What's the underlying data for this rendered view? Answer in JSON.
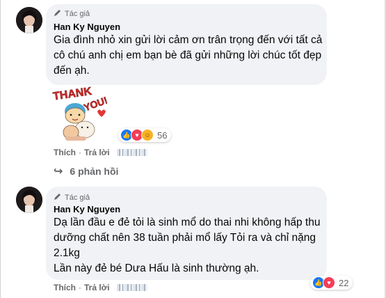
{
  "comments": [
    {
      "badge": "Tác giả",
      "author": "Han Ky Nguyen",
      "lines": [
        "Gia đình nhỏ xin gửi lời cảm ơn trân trọng đến với tất cả",
        "cô chú anh chị em bạn bè đã gửi những lời chúc tốt đẹp",
        "đến ạh."
      ],
      "sticker_text": [
        "THANK",
        "YOU!"
      ],
      "reactions": {
        "icons": [
          "like-icon",
          "love-icon",
          "care-icon"
        ],
        "count": "56"
      },
      "actions": {
        "like": "Thích",
        "separator": "·",
        "reply": "Trả lời"
      },
      "replies_label": "6 phản hồi"
    },
    {
      "badge": "Tác giả",
      "author": "Han Ky Nguyen",
      "lines": [
        "Dạ lần đầu e đẻ tỏi là sinh mổ do thai nhi không hấp thu",
        "dưỡng chất nên 38 tuần phải mổ lấy Tỏi ra và chỉ nặng",
        "2.1kg",
        "Lần này đẻ bé Dưa Hấu là sinh thường ạh."
      ],
      "reactions": {
        "icons": [
          "like-icon",
          "love-icon"
        ],
        "count": "22"
      },
      "actions": {
        "like": "Thích",
        "separator": "·",
        "reply": "Trả lời"
      }
    }
  ],
  "colors": {
    "bubble": "#f0f2f5",
    "meta": "#65676b",
    "like": "#1877f2",
    "love": "#f33e58",
    "care": "#f7b125"
  }
}
